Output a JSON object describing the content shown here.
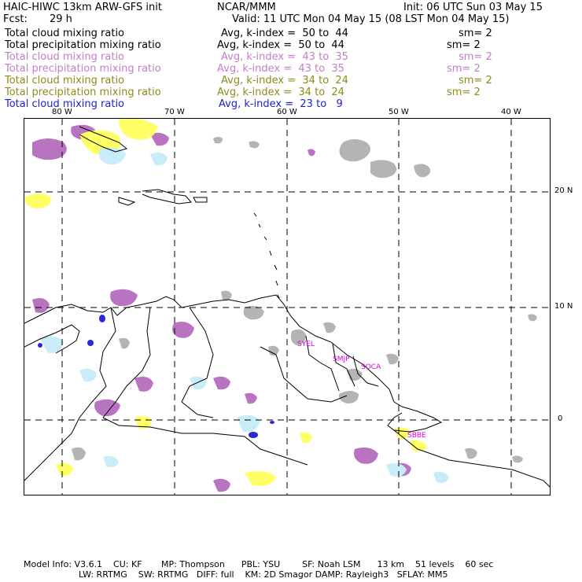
{
  "header": {
    "title": "HAIC-HIWC 13km ARW-GFS init",
    "org": "NCAR/MMM",
    "init": "Init: 06 UTC Sun 03 May 15",
    "fcst_label": "Fcst:",
    "fcst_value": "29 h",
    "valid": "Valid: 11 UTC Mon 04 May 15 (08 LST Mon 04 May 15)"
  },
  "legend": [
    {
      "name": "Total cloud mixing ratio",
      "avg": "Avg, k-index =  50 to  44",
      "sm": "sm= 2",
      "color": "#000000"
    },
    {
      "name": "Total precipitation mixing ratio",
      "avg": "Avg, k-index =  50 to  44",
      "sm": "sm= 2",
      "color": "#000000"
    },
    {
      "name": "Total cloud mixing ratio",
      "avg": "Avg, k-index =  43 to  35",
      "sm": "sm= 2",
      "color": "#c080c8"
    },
    {
      "name": "Total precipitation mixing ratio",
      "avg": "Avg, k-index =  43 to  35",
      "sm": "sm= 2",
      "color": "#c080c8"
    },
    {
      "name": "Total cloud mixing ratio",
      "avg": "Avg, k-index =  34 to  24",
      "sm": "sm= 2",
      "color": "#8c8c1a"
    },
    {
      "name": "Total precipitation mixing ratio",
      "avg": "Avg, k-index =  34 to  24",
      "sm": "sm= 2",
      "color": "#8c8c1a"
    },
    {
      "name": "Total cloud mixing ratio",
      "avg": "Avg, k-index =  23 to   9",
      "sm": "",
      "color": "#1e1ed2"
    }
  ],
  "axes": {
    "lon_labels": [
      "80 W",
      "70 W",
      "60 W",
      "50 W",
      "40 W"
    ],
    "lat_labels": [
      "20 N",
      "10 N",
      "0"
    ]
  },
  "stations": [
    "SYEL",
    "SMJP",
    "SOCA",
    "SBBE"
  ],
  "colors": {
    "gray": "#b4b4b4",
    "purple": "#b874c0",
    "yellow": "#ffff66",
    "lightblue": "#c8ecf8",
    "blue": "#2828d8",
    "station": "#e000e0"
  },
  "footer": {
    "line1": "Model Info: V3.6.1    CU: KF       MP: Thompson      PBL: YSU        SF: Noah LSM      13 km    51 levels    60 sec",
    "line2": "LW: RRTMG    SW: RRTMG   DIFF: full    KM: 2D Smagor DAMP: Rayleigh3   SFLAY: MM5"
  }
}
